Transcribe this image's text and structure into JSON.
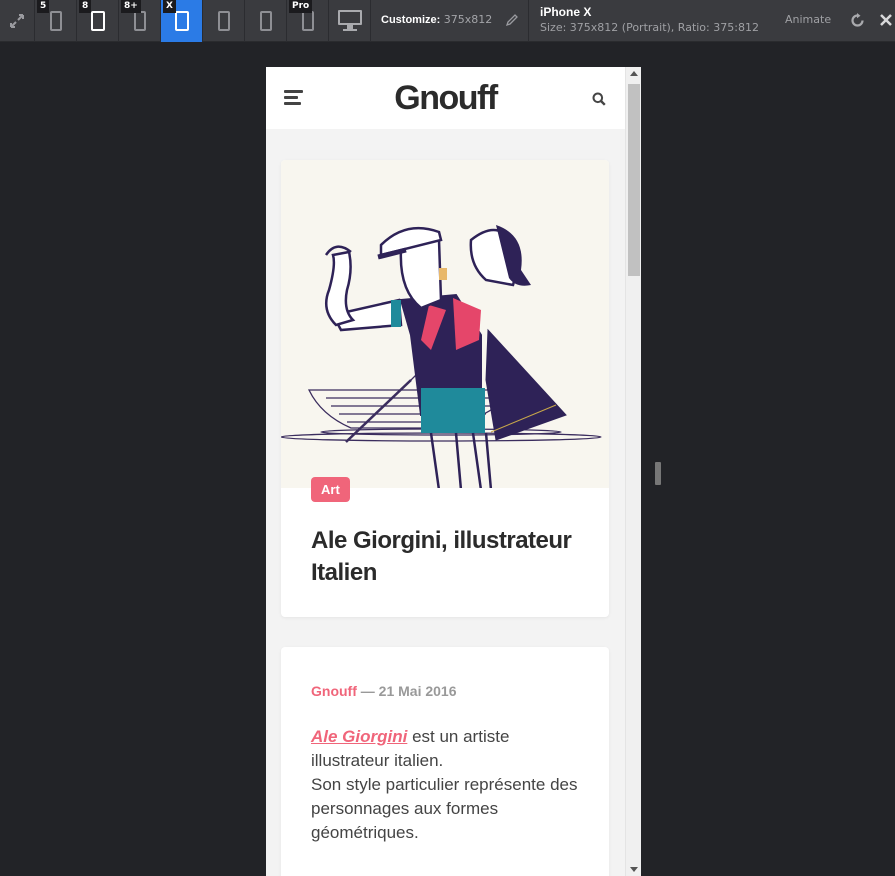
{
  "toolbar": {
    "devices": [
      {
        "badge": "5",
        "active": false
      },
      {
        "badge": "8",
        "active": false
      },
      {
        "badge": "8+",
        "active": false
      },
      {
        "badge": "X",
        "active": true
      },
      {
        "badge": "",
        "active": false
      },
      {
        "badge": "",
        "active": false
      },
      {
        "badge": "Pro",
        "active": false
      }
    ],
    "customize_label": "Customize:",
    "customize_value": "375x812",
    "device_name": "iPhone X",
    "device_size": "Size: 375x812 (Portrait), Ratio: 375:812",
    "animate_label": "Animate",
    "accent": "#2b7be6"
  },
  "site": {
    "logo": "Gnouff",
    "accent": "#f0657a"
  },
  "hero_card": {
    "tag": "Art",
    "title": "Ale Giorgini, illustrateur Italien"
  },
  "body_card": {
    "author": "Gnouff",
    "date": "— 21 Mai 2016",
    "link_text": "Ale Giorgini",
    "text_1": " est un artiste illustrateur italien.",
    "text_2": "Son style particulier représente des personnages aux formes géométriques."
  }
}
